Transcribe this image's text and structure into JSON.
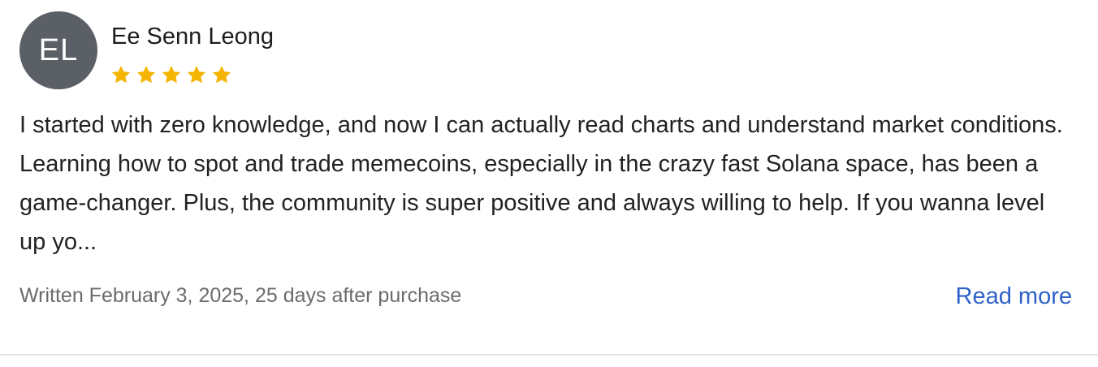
{
  "review": {
    "avatar_initials": "EL",
    "reviewer_name": "Ee Senn Leong",
    "rating": 5,
    "rating_max": 5,
    "star_color": "#f5b400",
    "text": "I started with zero knowledge, and now I can actually read charts and understand market conditions. Learning how to spot and trade memecoins, especially in the crazy fast Solana space, has been a game-changer. Plus, the community is super positive and always willing to help. If you wanna level up yo...",
    "meta": "Written February 3, 2025, 25 days after purchase",
    "read_more_label": "Read more"
  }
}
